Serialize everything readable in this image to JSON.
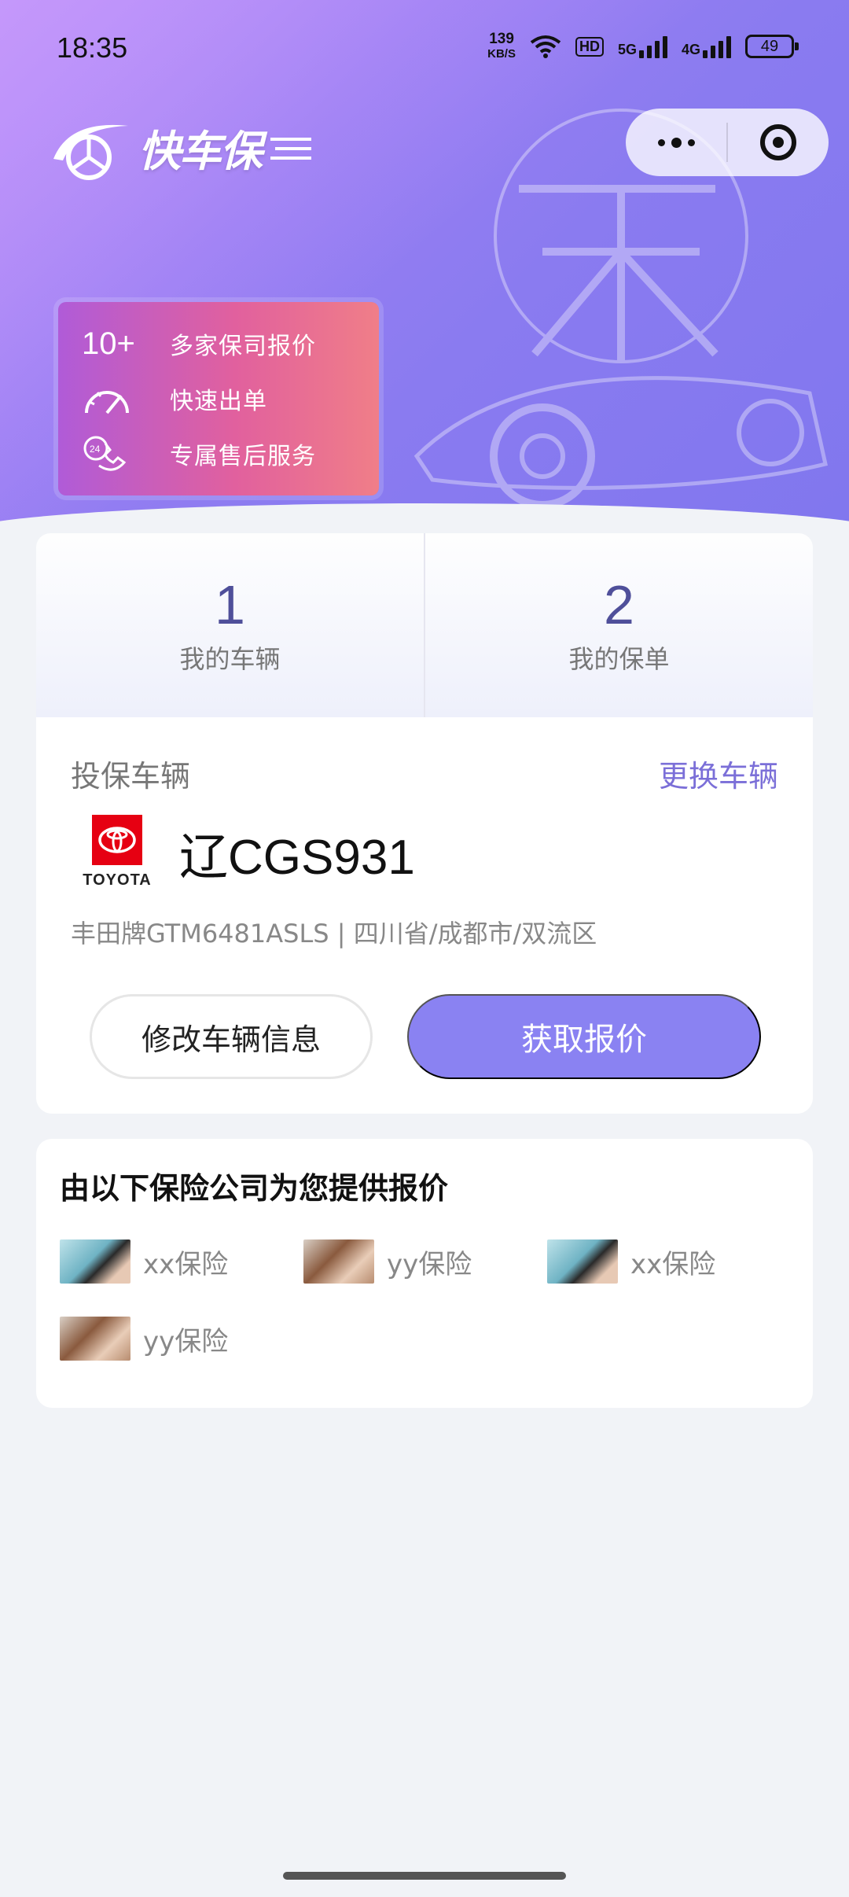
{
  "status_bar": {
    "time": "18:35",
    "net_speed_value": "139",
    "net_speed_unit": "KB/S",
    "hd_label": "HD",
    "sig1_label": "5G",
    "sig2_label": "4G",
    "battery": "49"
  },
  "header": {
    "logo_text": "快车保"
  },
  "promo": {
    "items": [
      {
        "icon": "ten-plus-icon",
        "icon_text": "10+",
        "label": "多家保司报价"
      },
      {
        "icon": "speedometer-icon",
        "label": "快速出单"
      },
      {
        "icon": "support-phone-icon",
        "label": "专属售后服务"
      }
    ]
  },
  "stats": {
    "vehicles_count": "1",
    "vehicles_label": "我的车辆",
    "policies_count": "2",
    "policies_label": "我的保单"
  },
  "vehicle": {
    "section_title": "投保车辆",
    "change_link": "更换车辆",
    "brand_logo_text": "TOYOTA",
    "plate": "辽CGS931",
    "description": "丰田牌GTM6481ASLS | 四川省/成都市/双流区",
    "edit_button": "修改车辆信息",
    "quote_button": "获取报价"
  },
  "insurers": {
    "title": "由以下保险公司为您提供报价",
    "items": [
      {
        "name": "xx保险"
      },
      {
        "name": "yy保险"
      },
      {
        "name": "xx保险"
      },
      {
        "name": "yy保险"
      }
    ]
  },
  "colors": {
    "accent": "#8a82f2",
    "link": "#7b6fd8",
    "stat_number": "#4f4f9a",
    "toyota_red": "#e60012"
  }
}
